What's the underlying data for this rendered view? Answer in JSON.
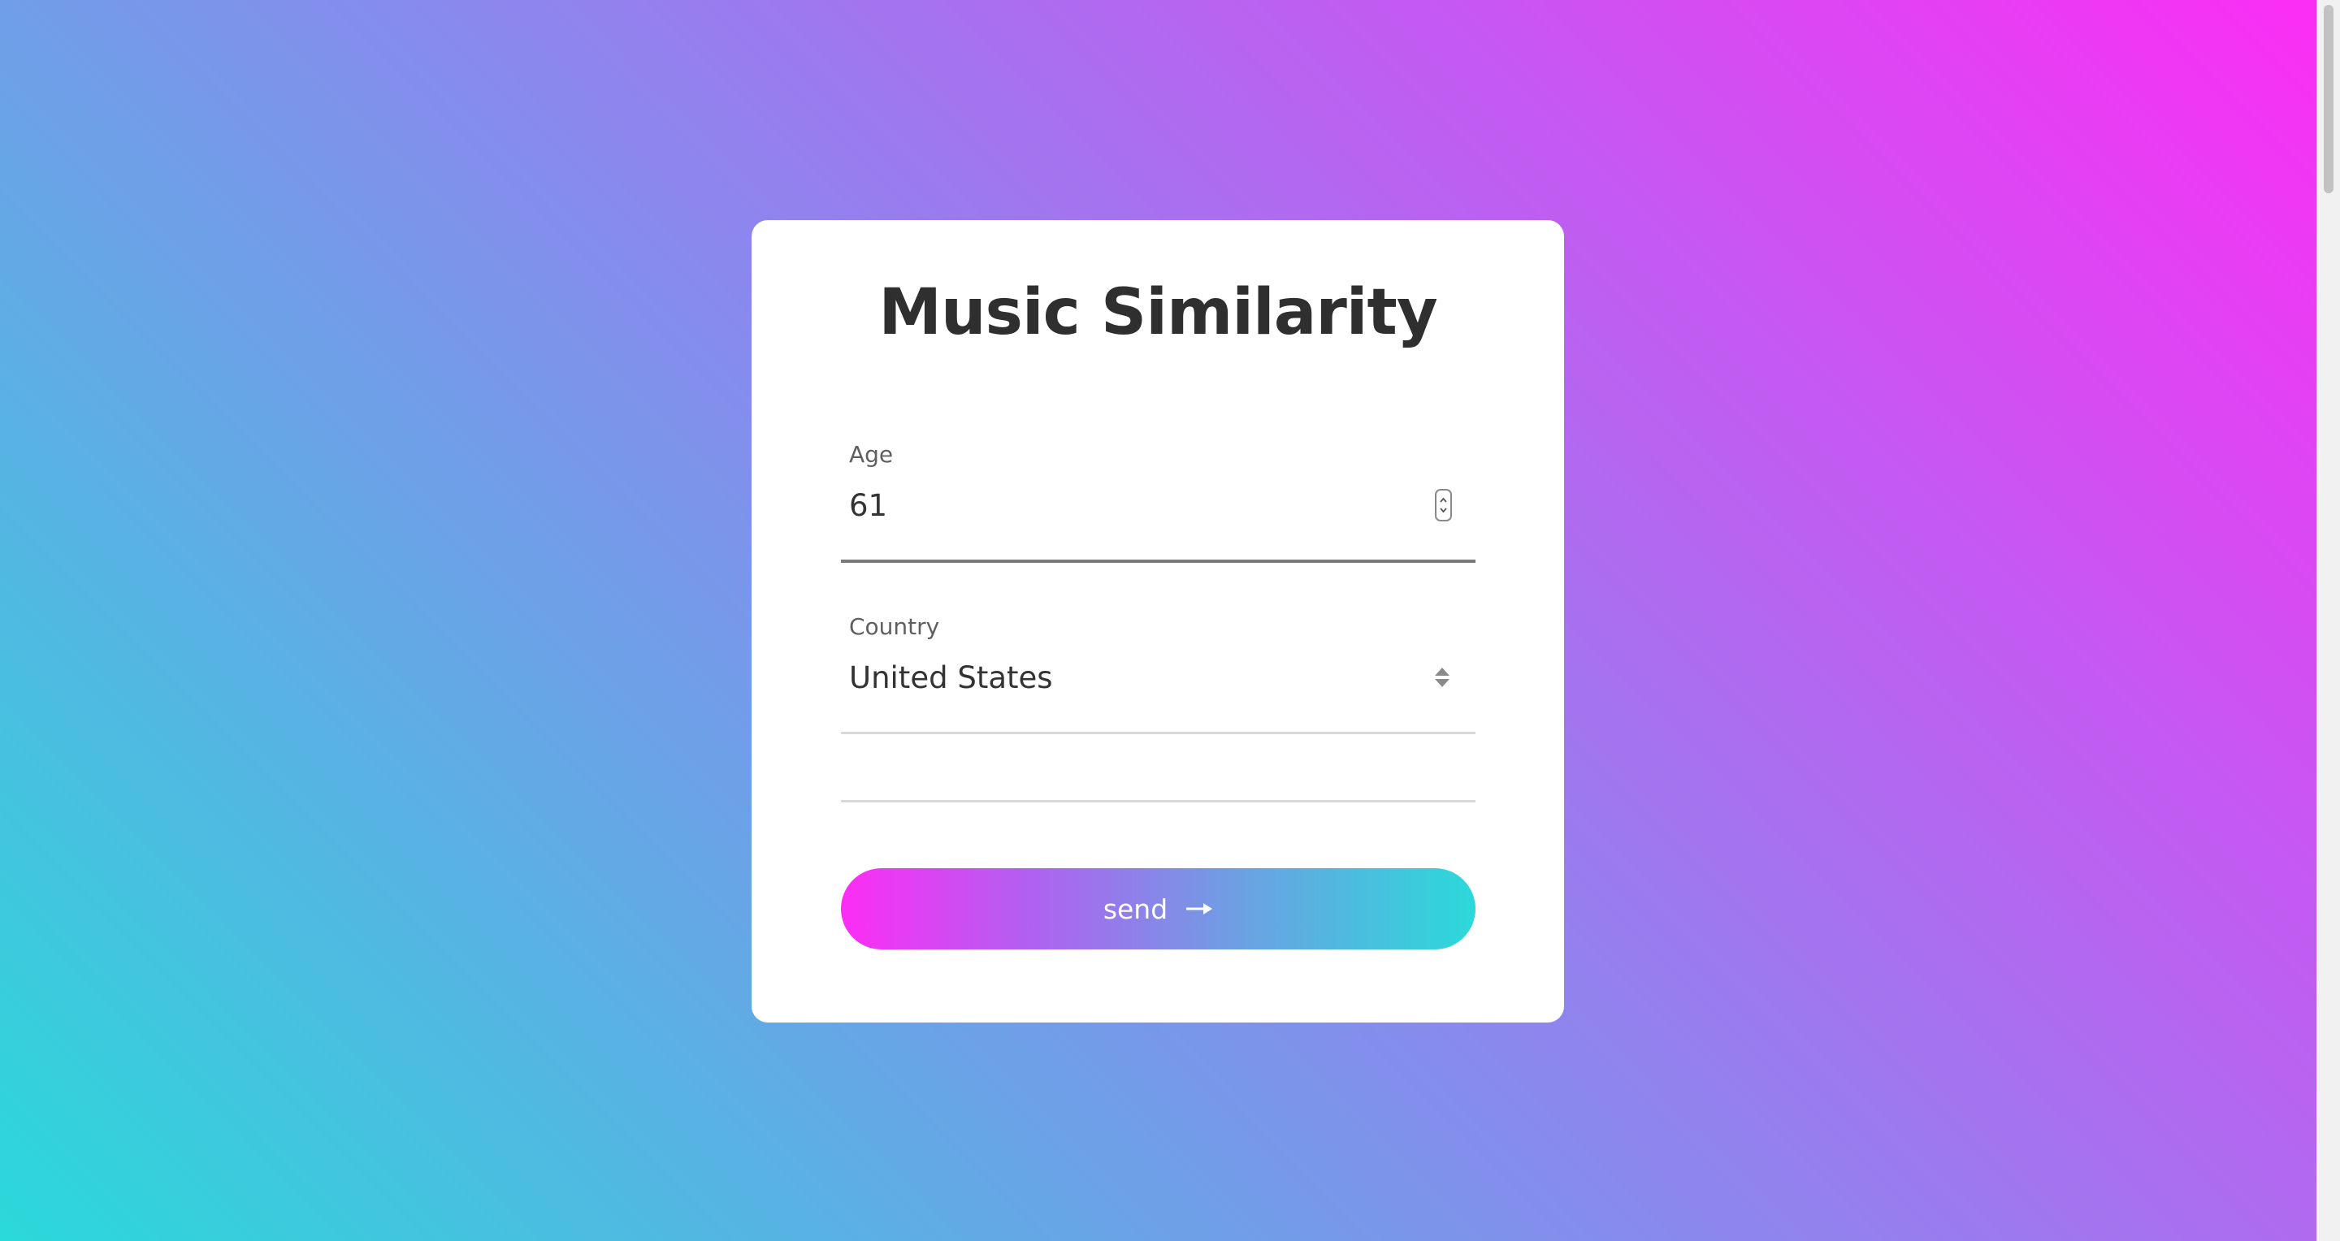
{
  "app": {
    "title": "Music Similarity"
  },
  "form": {
    "age": {
      "label": "Age",
      "value": "61"
    },
    "country": {
      "label": "Country",
      "selected": "United States"
    },
    "send_label": "send"
  },
  "icons": {
    "stepper": "number-stepper-icon",
    "select": "select-arrows-icon",
    "send": "arrow-right-icon"
  },
  "colors": {
    "gradient_start": "#2ad9da",
    "gradient_mid": "#8f84ee",
    "gradient_end": "#fd2cf5",
    "card": "#ffffff",
    "title_text": "#2f2f2f"
  }
}
